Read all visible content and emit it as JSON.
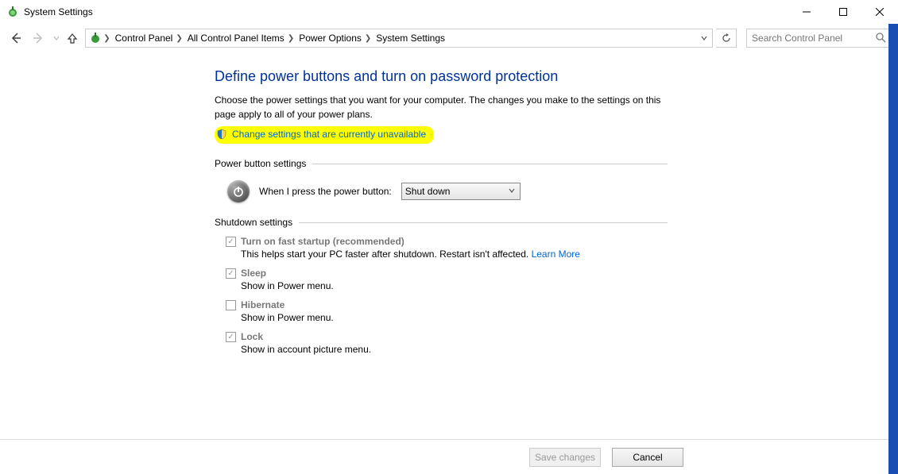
{
  "window": {
    "title": "System Settings"
  },
  "breadcrumb": {
    "items": [
      "Control Panel",
      "All Control Panel Items",
      "Power Options",
      "System Settings"
    ]
  },
  "search": {
    "placeholder": "Search Control Panel"
  },
  "page": {
    "title": "Define power buttons and turn on password protection",
    "intro": "Choose the power settings that you want for your computer. The changes you make to the settings on this page apply to all of your power plans.",
    "change_link": "Change settings that are currently unavailable"
  },
  "sections": {
    "power_button": {
      "header": "Power button settings",
      "label": "When I press the power button:",
      "selected": "Shut down"
    },
    "shutdown": {
      "header": "Shutdown settings",
      "fast_startup": {
        "label": "Turn on fast startup (recommended)",
        "desc": "This helps start your PC faster after shutdown. Restart isn't affected. ",
        "learn": "Learn More",
        "checked": true
      },
      "sleep": {
        "label": "Sleep",
        "desc": "Show in Power menu.",
        "checked": true
      },
      "hibernate": {
        "label": "Hibernate",
        "desc": "Show in Power menu.",
        "checked": false
      },
      "lock": {
        "label": "Lock",
        "desc": "Show in account picture menu.",
        "checked": true
      }
    }
  },
  "footer": {
    "save": "Save changes",
    "cancel": "Cancel"
  }
}
